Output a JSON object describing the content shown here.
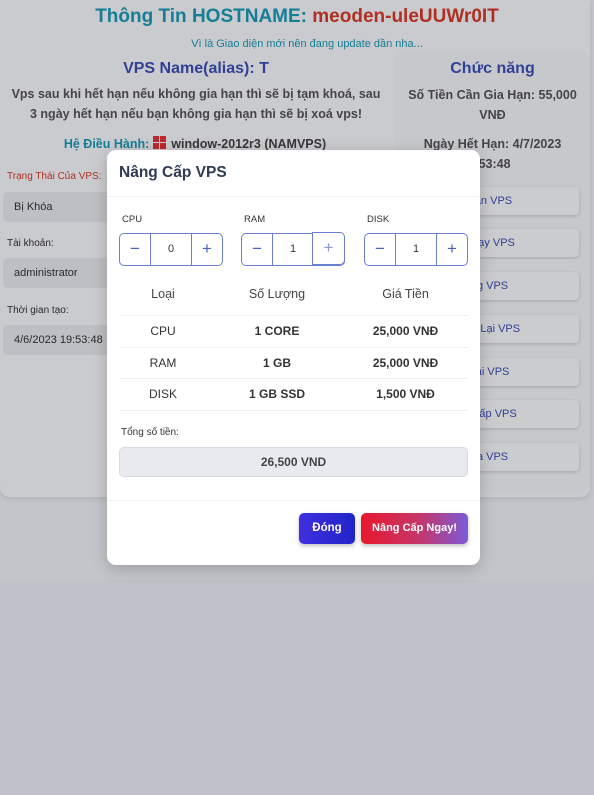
{
  "page": {
    "hostname_label": "Thông Tin HOSTNAME:",
    "hostname": "meoden-uleUUWr0IT",
    "update_note": "Vì là Giao diện mới nên đang update dần nha...",
    "vps_name": "VPS Name(alias): T",
    "warning": "Vps sau khi hết hạn nếu không gia hạn thì sẽ bị tạm khoá, sau 3 ngày hết hạn nếu bạn không gia hạn thì sẽ bị xoá vps!",
    "os_label": "Hệ Điều Hành:",
    "os_value": "window-2012r3 (NAMVPS)",
    "status_label": "Trạng Thái Của VPS:",
    "status_value": "Bị Khóa",
    "account_label": "Tài khoản:",
    "account_value": "administrator",
    "created_label": "Thời gian tạo:",
    "created_value": "4/6/2023 19:53:48"
  },
  "sidebar": {
    "title": "Chức năng",
    "renew_cost": "Số Tiền Cần Gia Hạn: 55,000 VNĐ",
    "expiry_line1": "Ngày Hết Hạn: 4/7/2023",
    "expiry_line2": ":53:48",
    "buttons": [
      "Hạn VPS",
      "Chạy VPS",
      "ng VPS",
      "ộng Lại VPS",
      "Lại VPS",
      "g Cấp VPS",
      "ồa VPS"
    ]
  },
  "modal": {
    "title": "Nâng Cấp VPS",
    "steppers": [
      {
        "label": "CPU",
        "value": "0"
      },
      {
        "label": "RAM",
        "value": "1"
      },
      {
        "label": "DISK",
        "value": "1"
      }
    ],
    "minus_symbol": "−",
    "plus_symbol": "+",
    "table": {
      "headers": [
        "Loại",
        "Số Lượng",
        "Giá Tiền"
      ],
      "rows": [
        [
          "CPU",
          "1 CORE",
          "25,000 VNĐ"
        ],
        [
          "RAM",
          "1 GB",
          "25,000 VNĐ"
        ],
        [
          "DISK",
          "1 GB SSD",
          "1,500 VNĐ"
        ]
      ]
    },
    "total_label": "Tổng số tiền:",
    "total_value": "26,500 VND",
    "close_label": "Đóng",
    "upgrade_label": "Nâng Cấp Ngay!"
  },
  "colors": {
    "accent_blue": "#3c4fb8",
    "teal": "#1a9ab8",
    "red": "#d63b2a"
  },
  "icons": {
    "os": "windows-logo-icon"
  }
}
